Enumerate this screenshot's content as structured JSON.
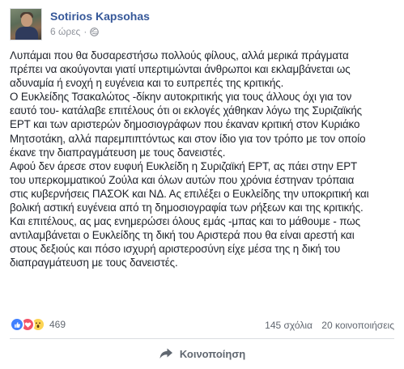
{
  "post": {
    "author": "Sotirios Kapsohas",
    "time": "6 ώρες",
    "separator": "·",
    "privacy_icon": "globe-icon",
    "text_lines": [
      "Λυπάμαι που θα δυσαρεστήσω πολλούς φίλους, αλλά μερικά πράγματα",
      "πρέπει να ακούγονται γιατί υπερτιμώνται άνθρωποι και εκλαμβάνεται ως",
      "αδυναμία ή ενοχή η ευγένεια και το ευπρεπές της κριτικής.",
      "Ο Ευκλείδης Τσακαλώτος -δίκην αυτοκριτικής για τους άλλους όχι για τον",
      "εαυτό του- κατάλαβε επιτέλους ότι οι εκλογές χάθηκαν λόγω της Συριζαϊκής",
      "ΕΡΤ και των αριστερών δημοσιογράφων που έκαναν κριτική στον Κυριάκο",
      "Μητσοτάκη, αλλά παρεμπιπτόντως και στον ίδιο για τον τρόπο με τον οποίο",
      "έκανε την διαπραγμάτευση με τους δανειστές.",
      "Αφού δεν άρεσε στον ευφυή Ευκλείδη η Συριζαϊκή ΕΡΤ, ας πάει στην ΕΡΤ",
      "του υπερκομματικού Ζούλα και όλων αυτών που χρόνια έστηναν τρόπαια",
      "στις κυβερνήσεις ΠΑΣΟΚ και ΝΔ. Ας επιλέξει ο Ευκλείδης την υποκριτική και",
      "βολική αστική ευγένεια από τη δημοσιογραφία των ρήξεων και της κριτικής.",
      "Και επιτέλους, ας μας ενημερώσει όλους εμάς -μπας και το μάθουμε - πως",
      "αντιλαμβάνεται ο Ευκλείδης τη δική του Αριστερά που θα είναι αρεστή και",
      "στους δεξιούς και πόσο ισχυρή αριστεροσύνη είχε μέσα της η δική του",
      "διαπραγμάτευση με τους δανειστές."
    ]
  },
  "stats": {
    "reactions_count": "469",
    "reaction_icons": [
      "like-icon",
      "love-icon",
      "wow-icon"
    ],
    "comments": "145 σχόλια",
    "shares": "20 κοινοποιήσεις"
  },
  "actions": {
    "share_label": "Κοινοποίηση",
    "share_icon": "share-arrow-icon"
  },
  "colors": {
    "author_link": "#365899",
    "meta_gray": "#90949c",
    "like_blue": "#4080ff",
    "love_red": "#f25268",
    "wow_yellow": "#fcd454"
  }
}
